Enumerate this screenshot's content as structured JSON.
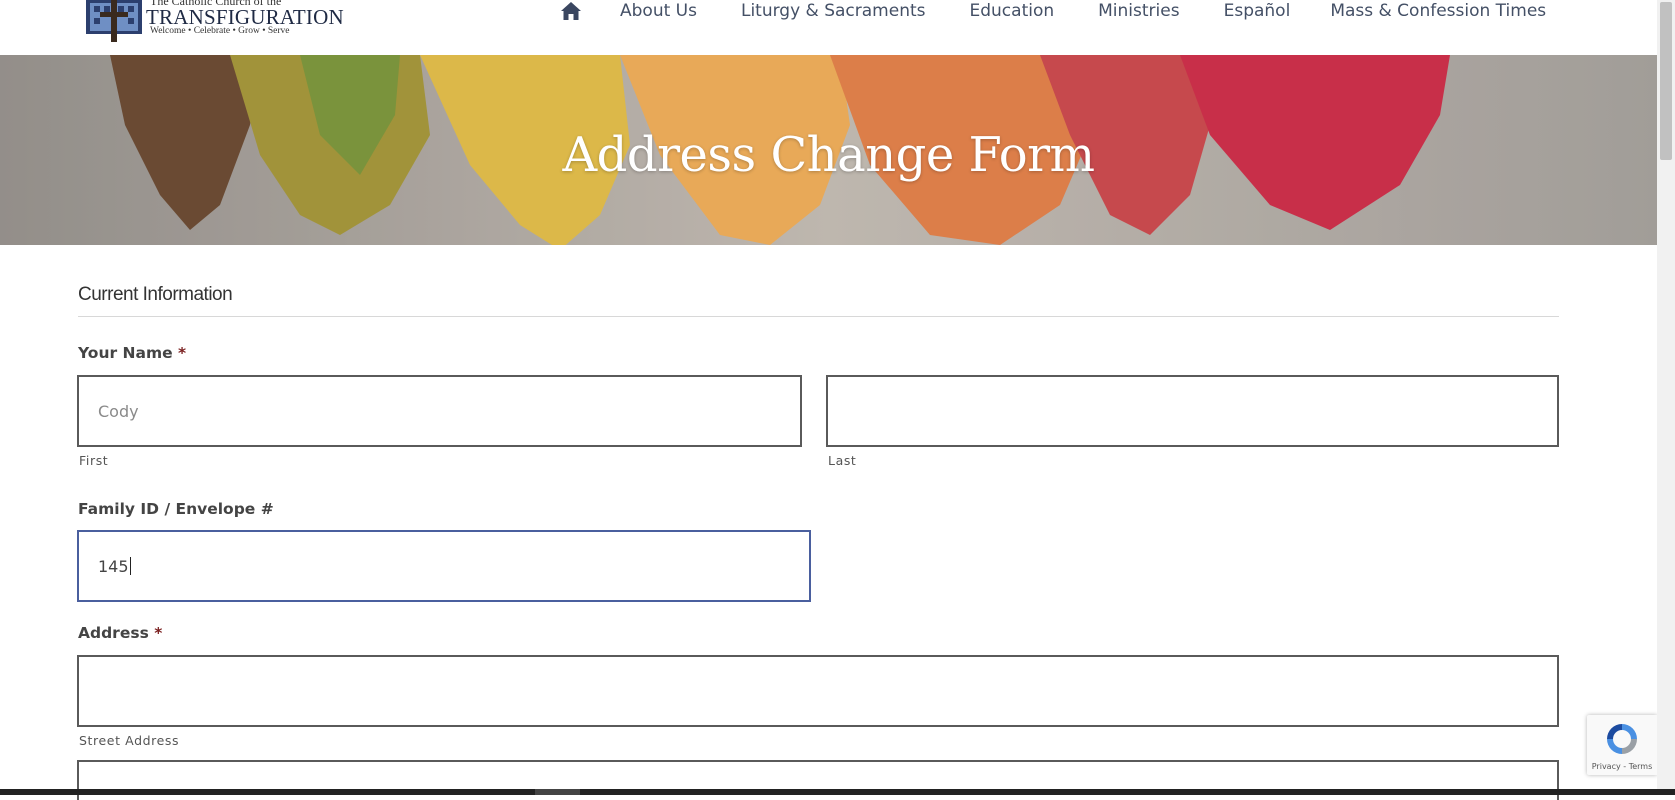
{
  "header": {
    "logo": {
      "line1": "The Catholic Church of the",
      "line2": "TRANSFIGURATION",
      "line3": "Welcome • Celebrate • Grow • Serve"
    },
    "nav": {
      "home_icon": "home-icon",
      "items": [
        "About Us",
        "Liturgy & Sacraments",
        "Education",
        "Ministries",
        "Español",
        "Mass & Confession Times"
      ]
    }
  },
  "banner": {
    "title": "Address Change Form"
  },
  "form": {
    "section_title": "Current Information",
    "name": {
      "label": "Your Name",
      "required_mark": "*",
      "first_value": "Cody",
      "first_sublabel": "First",
      "last_value": "",
      "last_sublabel": "Last"
    },
    "family_id": {
      "label": "Family ID / Envelope #",
      "value": "145"
    },
    "address": {
      "label": "Address",
      "required_mark": "*",
      "street_value": "",
      "street_sublabel": "Street Address"
    }
  },
  "recaptcha": {
    "text": "Privacy - Terms"
  },
  "colors": {
    "nav_text": "#445066",
    "field_border": "#5a5a5a",
    "focus_border": "#4a5f9e",
    "required": "#7a1f1f"
  }
}
